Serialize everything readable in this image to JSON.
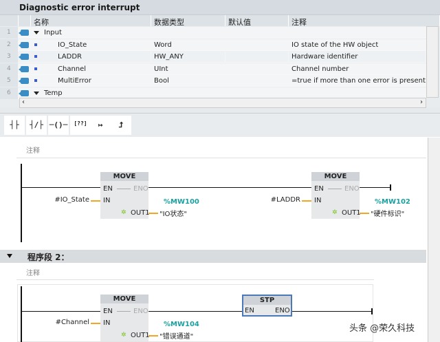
{
  "title": "Diagnostic error interrupt",
  "table": {
    "headers": {
      "name": "名称",
      "type": "数据类型",
      "default": "默认值",
      "comment": "注释"
    },
    "rows": [
      {
        "num": "1",
        "name": "Input",
        "type": "",
        "comment": "",
        "kind": "section"
      },
      {
        "num": "2",
        "name": "IO_State",
        "type": "Word",
        "comment": "IO state of the HW object",
        "kind": "param"
      },
      {
        "num": "3",
        "name": "LADDR",
        "type": "HW_ANY",
        "comment": "Hardware identifier",
        "kind": "param"
      },
      {
        "num": "4",
        "name": "Channel",
        "type": "UInt",
        "comment": "Channel number",
        "kind": "param"
      },
      {
        "num": "5",
        "name": "MultiError",
        "type": "Bool",
        "comment": "=true if more than one error is present",
        "kind": "param"
      },
      {
        "num": "6",
        "name": "Temp",
        "type": "",
        "comment": "",
        "kind": "section"
      }
    ]
  },
  "toolbar": {
    "items": [
      "┤├",
      "┤/├",
      "─()─",
      "[??]",
      "↦",
      "⮥"
    ]
  },
  "networks": [
    {
      "comment": "注释",
      "blocks": [
        {
          "title": "MOVE",
          "en": "EN",
          "eno": "ENO",
          "in": "IN",
          "out": "OUT1",
          "in_var": "#IO_State",
          "out_addr": "%MW100",
          "out_sym": "\"IO状态\""
        },
        {
          "title": "MOVE",
          "en": "EN",
          "eno": "ENO",
          "in": "IN",
          "out": "OUT1",
          "in_var": "#LADDR",
          "out_addr": "%MW102",
          "out_sym": "\"硬件标识\""
        }
      ]
    },
    {
      "title": "程序段 2：",
      "comment": "注释",
      "blocks": [
        {
          "title": "MOVE",
          "en": "EN",
          "eno": "ENO",
          "in": "IN",
          "out": "OUT1",
          "in_var": "#Channel",
          "out_addr": "%MW104",
          "out_sym": "\"错误通道\""
        },
        {
          "title": "STP",
          "en": "EN",
          "eno": "ENO"
        }
      ]
    }
  ],
  "watermark": "头条 @荣久科技"
}
